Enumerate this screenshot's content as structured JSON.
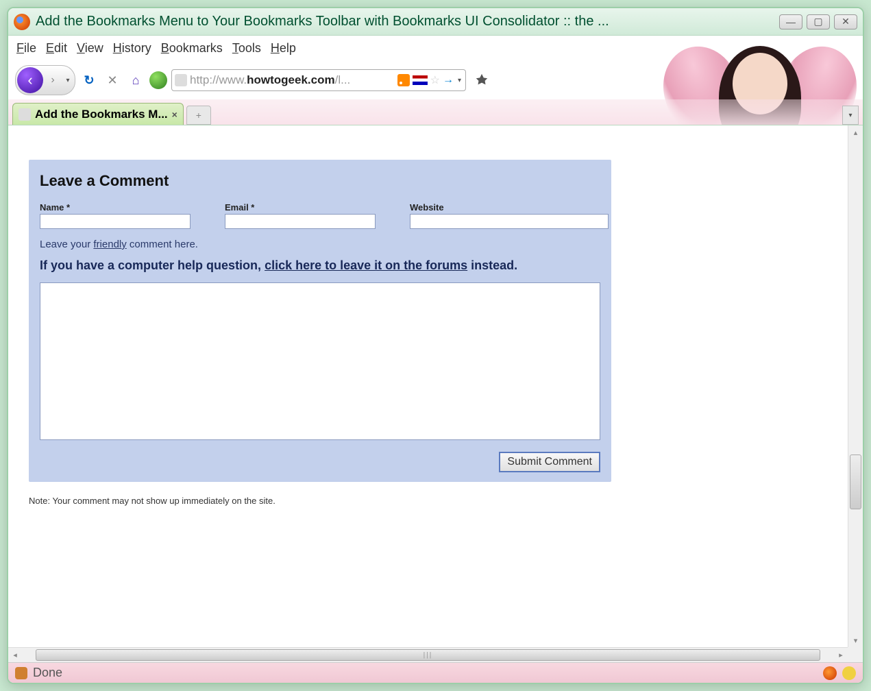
{
  "window": {
    "title": "Add the Bookmarks Menu to Your Bookmarks Toolbar with Bookmarks UI Consolidator :: the ..."
  },
  "menubar": [
    "File",
    "Edit",
    "View",
    "History",
    "Bookmarks",
    "Tools",
    "Help"
  ],
  "url": {
    "prefix": "http://www.",
    "domain": "howtogeek.com",
    "suffix": "/l..."
  },
  "tab": {
    "label": "Add the Bookmarks M..."
  },
  "comment": {
    "heading": "Leave a Comment",
    "name_label": "Name *",
    "email_label": "Email *",
    "website_label": "Website",
    "name_value": "",
    "email_value": "",
    "website_value": "",
    "hint_prefix": "Leave your ",
    "hint_link": "friendly",
    "hint_suffix": " comment here.",
    "forum_prefix": "If you have a computer help question, ",
    "forum_link": "click here to leave it on the forums",
    "forum_suffix": " instead.",
    "textarea_value": "",
    "submit_label": "Submit Comment",
    "note": "Note: Your comment may not show up immediately on the site."
  },
  "status": {
    "text": "Done"
  }
}
